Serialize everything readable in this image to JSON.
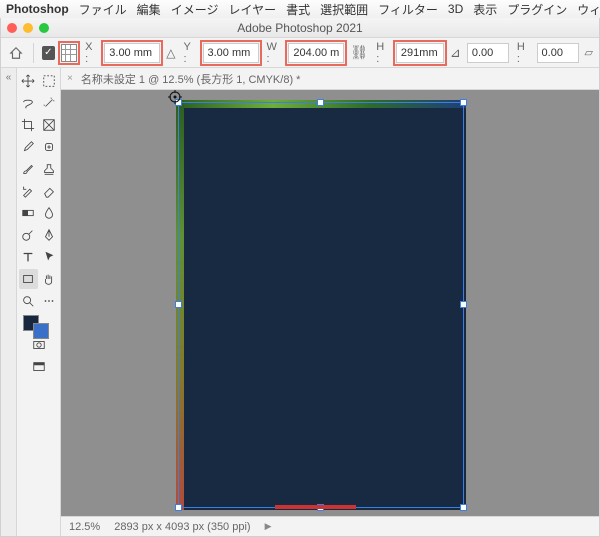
{
  "menu": {
    "app": "Photoshop",
    "items": [
      "ファイル",
      "編集",
      "イメージ",
      "レイヤー",
      "書式",
      "選択範囲",
      "フィルター",
      "3D",
      "表示",
      "プラグイン",
      "ウィン"
    ]
  },
  "window": {
    "title": "Adobe Photoshop 2021"
  },
  "options": {
    "x_label": "X :",
    "x_value": "3.00 mm",
    "y_label": "Y :",
    "y_value": "3.00 mm",
    "w_label": "W :",
    "w_value": "204.00 m",
    "h_label": "H :",
    "h_value": "291mm",
    "angle_value": "0.00",
    "skew_label": "H :",
    "skew_value": "0.00"
  },
  "doc_tab": {
    "name": "名称未設定 1 @ 12.5% (長方形 1, CMYK/8) *"
  },
  "status": {
    "zoom": "12.5%",
    "dims": "2893 px x 4093 px (350 ppi)"
  },
  "colors": {
    "fg": "#18273d",
    "bg": "#3b70c9"
  },
  "icons": {
    "home": "home",
    "reference": "reference-point",
    "triangle": "delta",
    "link": "link",
    "angle": "angle",
    "skew": "skew"
  }
}
